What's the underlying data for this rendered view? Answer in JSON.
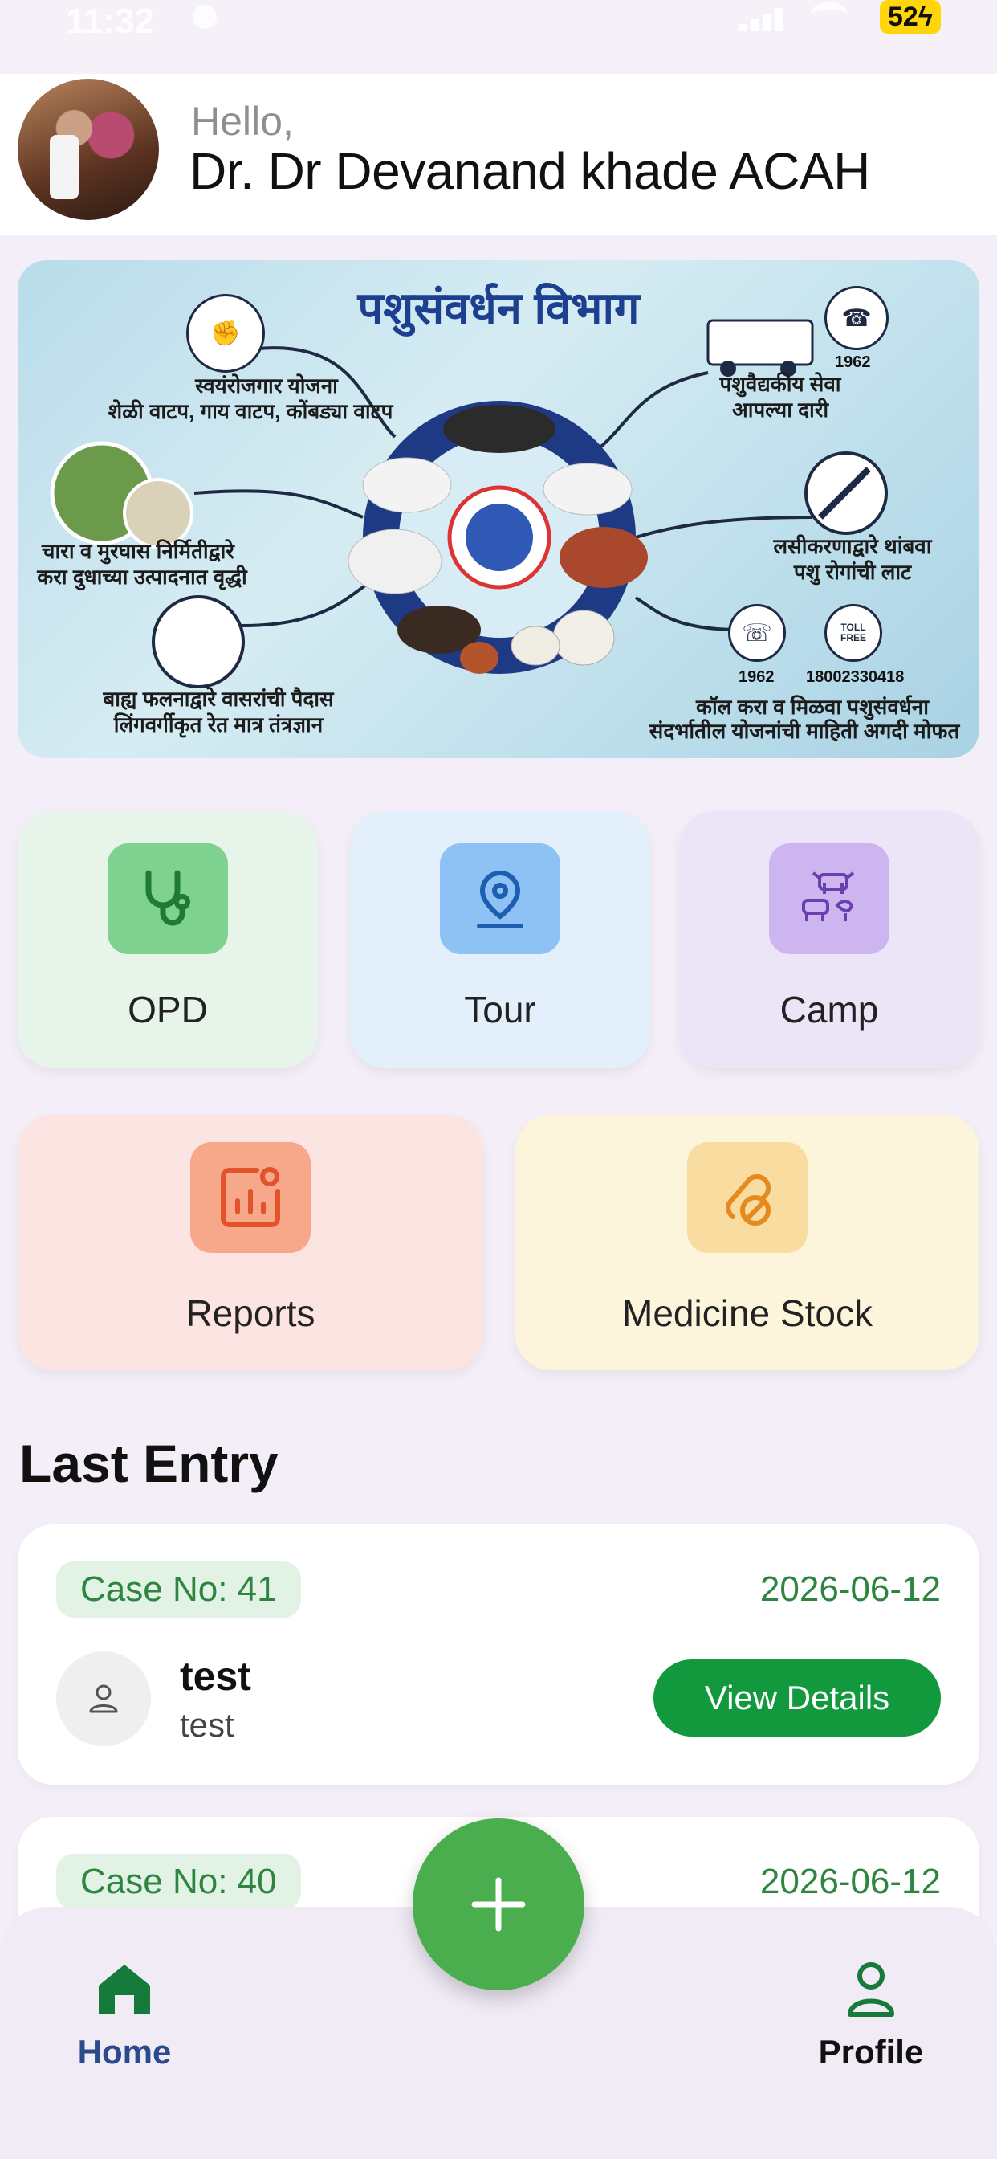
{
  "status_bar": {
    "time": "11:32",
    "battery": "52"
  },
  "header": {
    "greeting": "Hello,",
    "doctor_name": "Dr. Dr Devanand khade ACAH"
  },
  "banner": {
    "title": "पशुसंवर्धन विभाग",
    "items": [
      "स्वयंरोजगार योजना",
      "शेळी वाटप, गाय वाटप, कोंबड्या वाटप",
      "पशुवैद्यकीय सेवा",
      "आपल्या दारी",
      "चारा व मुरघास निर्मितीद्वारे",
      "करा दुधाच्या उत्पादनात वृद्धी",
      "लसीकरणाद्वारे थांबवा",
      "पशु रोगांची लाट",
      "बाह्य फलनाद्वारे वासरांची पैदास",
      "लिंगवर्गीकृत रेत मात्र तंत्रज्ञान",
      "कॉल करा व मिळवा पशुसंवर्धना",
      "संदर्भातील योजनांची माहिती अगदी मोफत"
    ],
    "numbers": {
      "helpline": "1962",
      "helpline_2": "1962",
      "toll_free": "18002330418",
      "toll_free_label": "TOLL FREE"
    }
  },
  "tiles": {
    "opd": "OPD",
    "tour": "Tour",
    "camp": "Camp",
    "reports": "Reports",
    "medicine": "Medicine Stock"
  },
  "section_title": "Last Entry",
  "entries": [
    {
      "case": "Case No: 41",
      "date": "2026-06-12",
      "name": "test",
      "sub": "test",
      "action": "View Details"
    },
    {
      "case": "Case No: 40",
      "date": "2026-06-12"
    }
  ],
  "nav": {
    "home": "Home",
    "profile": "Profile"
  },
  "colors": {
    "accent_green": "#12993d",
    "fab_green": "#4aad4e",
    "home_blue": "#2a4a8c"
  },
  "icons": [
    "stethoscope-icon",
    "location-pin-icon",
    "cattle-icon",
    "report-chart-icon",
    "pill-icon",
    "user-icon",
    "plus-icon",
    "home-icon",
    "profile-icon"
  ]
}
